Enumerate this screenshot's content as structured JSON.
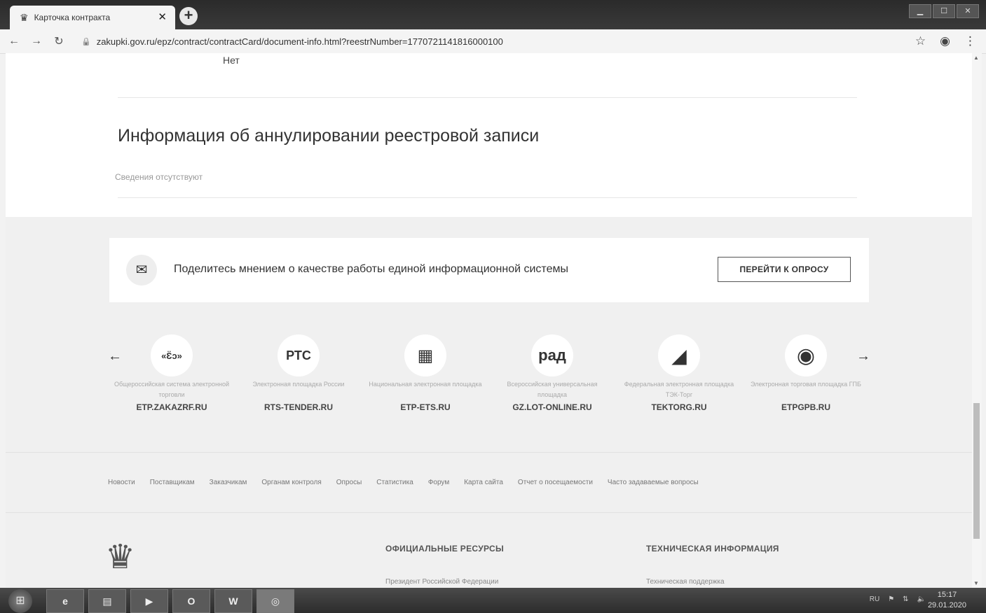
{
  "browser": {
    "tab_title": "Карточка контракта",
    "url": "zakupki.gov.ru/epz/contract/contractCard/document-info.html?reestrNumber=1770721141816000100"
  },
  "page": {
    "prev_value": "Нет",
    "section_title": "Информация об аннулировании реестровой записи",
    "no_info_text": "Сведения отсутствуют"
  },
  "survey": {
    "text": "Поделитесь мнением о качестве работы единой информационной системы",
    "button_label": "ПЕРЕЙТИ К ОПРОСУ"
  },
  "platforms": [
    {
      "logo": "«Ɛ̈ɔ»",
      "description": "Общероссийская система электронной торговли",
      "name": "ETP.ZAKAZRF.RU"
    },
    {
      "logo": "РТС",
      "description": "Электронная площадка России",
      "name": "RTS-TENDER.RU"
    },
    {
      "logo": "▦",
      "description": "Национальная электронная площадка",
      "name": "ETP-ETS.RU"
    },
    {
      "logo": "рад",
      "description": "Всероссийская универсальная площадка",
      "name": "GZ.LOT-ONLINE.RU"
    },
    {
      "logo": "◢",
      "description": "Федеральная электронная площадка ТЭК-Торг",
      "name": "TEKTORG.RU"
    },
    {
      "logo": "◉",
      "description": "Электронная торговая площадка ГПБ",
      "name": "ETPGPB.RU"
    }
  ],
  "footer_links": [
    "Новости",
    "Поставщикам",
    "Заказчикам",
    "Органам контроля",
    "Опросы",
    "Статистика",
    "Форум",
    "Карта сайта",
    "Отчет о посещаемости",
    "Часто задаваемые вопросы"
  ],
  "footer": {
    "col1_title": "ОФИЦИАЛЬНЫЕ РЕСУРСЫ",
    "col1_link": "Президент Российской Федерации",
    "col2_title": "ТЕХНИЧЕСКАЯ ИНФОРМАЦИЯ",
    "col2_link": "Техническая поддержка"
  },
  "taskbar": {
    "lang": "RU",
    "time": "15:17",
    "date": "29.01.2020"
  }
}
